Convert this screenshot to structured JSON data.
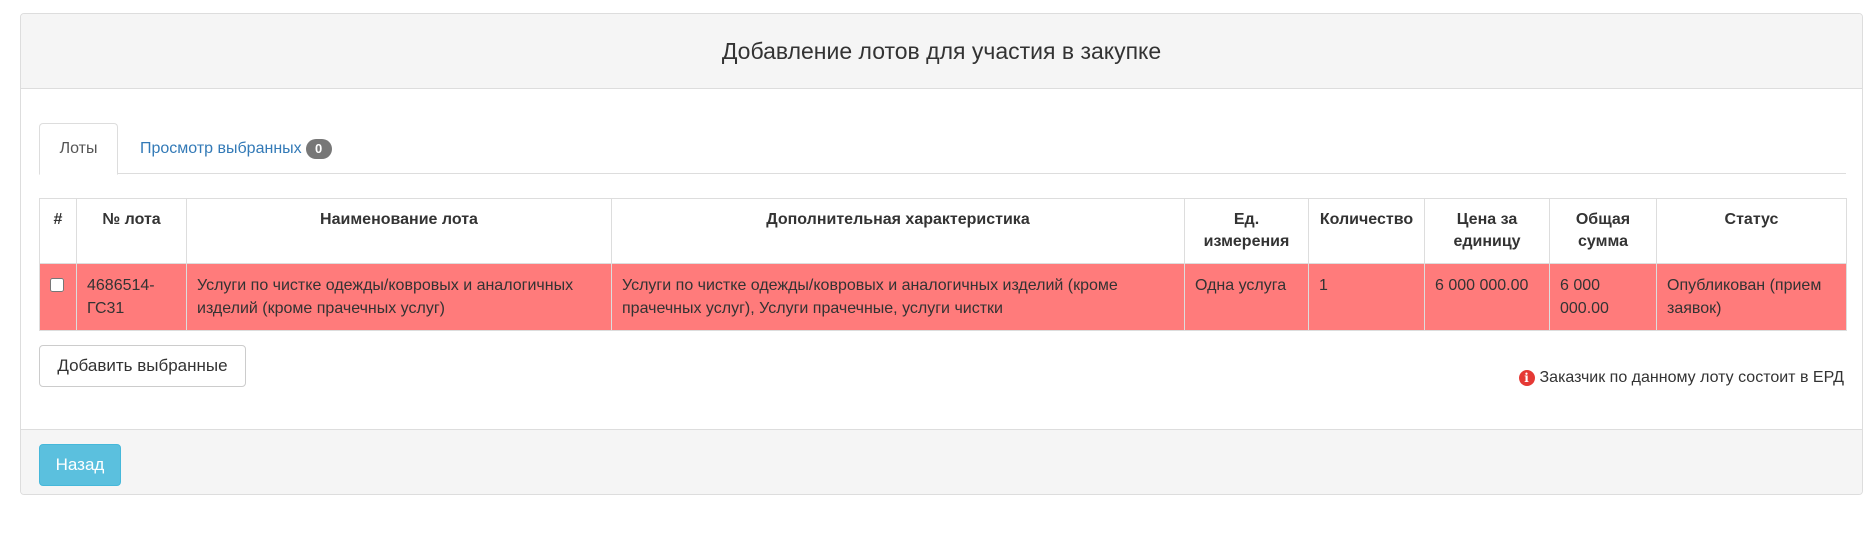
{
  "panel": {
    "title": "Добавление лотов для участия в закупке"
  },
  "tabs": [
    {
      "label": "Лоты",
      "active": true
    },
    {
      "label": "Просмотр выбранных",
      "badge": "0",
      "active": false
    }
  ],
  "table": {
    "headers": {
      "check": "#",
      "lot_no": "№ лота",
      "name": "Наименование лота",
      "extra": "Дополнительная характеристика",
      "unit": "Ед. измерения",
      "qty": "Количество",
      "price": "Цена за единицу",
      "total": "Общая сумма",
      "status": "Статус"
    },
    "rows": [
      {
        "lot_no": "4686514-ГС31",
        "name": "Услуги по чистке одежды/ковровых и аналогичных изделий (кроме прачечных услуг)",
        "extra": "Услуги по чистке одежды/ковровых и аналогичных изделий (кроме прачечных услуг), Услуги прачечные, услуги чистки",
        "unit": "Одна услуга",
        "qty": "1",
        "price": "6 000 000.00",
        "total": "6 000 000.00",
        "status": "Опубликован (прием заявок)",
        "checked": false,
        "highlight_color": "#ff7b7b"
      }
    ]
  },
  "actions": {
    "add_selected_label": "Добавить выбранные",
    "back_label": "Назад"
  },
  "notice": {
    "icon": "info-icon",
    "text": "Заказчик по данному лоту состоит в ЕРД"
  },
  "colors": {
    "danger_row": "#ff7b7b",
    "link": "#337ab7",
    "info_button": "#5bc0de",
    "notice_icon": "#e53935"
  }
}
